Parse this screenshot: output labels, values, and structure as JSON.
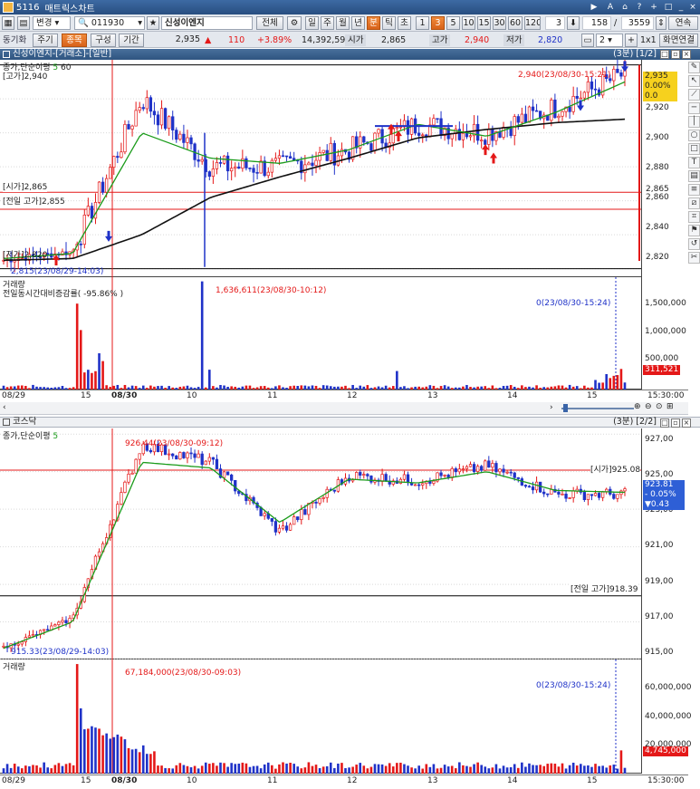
{
  "window": {
    "number": "5116",
    "title": "매트릭스차트",
    "controls": [
      "▶",
      "|",
      "A",
      "⌂",
      "?",
      "+",
      "□",
      "_",
      "□",
      "×"
    ]
  },
  "toolbar": {
    "change_label": "변경",
    "code": "011930",
    "name": "신성이엔지",
    "all_label": "전체",
    "periods": [
      "일",
      "주",
      "월",
      "년",
      "분",
      "틱",
      "초",
      "1",
      "3",
      "5",
      "10",
      "15",
      "30",
      "60",
      "120"
    ],
    "active_period": "분",
    "active_interval": "3",
    "interval_value": "3",
    "count_value": "158",
    "slash": "/",
    "total_value": "3559",
    "continuous_label": "연속",
    "sync_label": "동기화",
    "stock_btn": "주기",
    "item_btn": "종목",
    "config_btn": "구성",
    "period_btn": "기간",
    "price": "2,935",
    "change_arrow": "▲",
    "change": "110",
    "change_pct": "+3.89%",
    "volume": "14,392,599",
    "open_label": "시가",
    "open": "2,865",
    "high_label": "고가",
    "high": "2,940",
    "low_label": "저가",
    "low": "2,820",
    "split_value": "2",
    "scale_label": "1x1",
    "screen_label": "화면연결"
  },
  "chart1": {
    "header": "신성이엔지-[거래소]-[일반]",
    "page": "(3분) [1/2]",
    "legend": "종가,단순이평",
    "legend_ma": "5",
    "legend_ma2": "60",
    "high_label": "[고가]2,940",
    "price_ticks": [
      "2,920",
      "2,900",
      "2,880",
      "2,865",
      "2,860",
      "2,840",
      "2,820"
    ],
    "annotations": {
      "high": "2,940(23/08/30-15:21)",
      "low": "2,815(23/08/29-14:03)",
      "open": "[시가]2,865",
      "prev_high": "[전일 고가]2,855",
      "low_line": "[저가]2,820"
    },
    "price_badge": {
      "price": "2,935",
      "pct": "0.00%",
      "chg": "0.0"
    }
  },
  "volume1": {
    "label": "거래량",
    "sub": "전일동시간대비증감률( -95.86% )",
    "max_ann": "1,636,611(23/08/30-10:12)",
    "last_ann": "0(23/08/30-15:24)",
    "ticks": [
      "1,500,000",
      "1,000,000",
      "500,000"
    ],
    "badge": "311,521"
  },
  "xaxis": {
    "labels": [
      "08/29",
      "15",
      "08/30",
      "10",
      "11",
      "12",
      "13",
      "14",
      "15"
    ],
    "end": "15:30:00"
  },
  "chart2": {
    "header": "코스닥",
    "page": "(3분) [2/2]",
    "legend": "종가,단순이평",
    "legend_ma": "5",
    "ticks": [
      "927,00",
      "925,00",
      "923,00",
      "921,00",
      "919,00",
      "917,00",
      "915,00"
    ],
    "annotations": {
      "high": "926.44(23/08/30-09:12)",
      "low": "915.33(23/08/29-14:03)",
      "open": "[시가]925.08",
      "prev_high": "[전일 고가]918.39"
    },
    "badge": {
      "value": "923.81",
      "pct": "- 0.05%",
      "chg": "▼0.43"
    }
  },
  "volume2": {
    "label": "거래량",
    "max_ann": "67,184,000(23/08/30-09:03)",
    "last_ann": "0(23/08/30-15:24)",
    "ticks": [
      "60,000,000",
      "40,000,000",
      "20,000,000"
    ],
    "badge": "4,745,000"
  },
  "colors": {
    "up": "#e41818",
    "down": "#1f32c8",
    "ma5": "#1a9b1a",
    "ma60": "#111111",
    "bar": "#2f5580",
    "accent": "#e0661e"
  },
  "chart_data": [
    {
      "type": "line",
      "title": "신성이엔지-[거래소]-[일반]",
      "ylim": [
        2815,
        2943
      ],
      "x": [
        "08/29 13:00",
        "08/29 15:00",
        "08/30 09:00",
        "08/30 10:00",
        "08/30 11:00",
        "08/30 12:00",
        "08/30 13:00",
        "08/30 14:00",
        "08/30 15:00",
        "08/30 15:21"
      ],
      "series": [
        {
          "name": "종가",
          "values": [
            2825,
            2830,
            2920,
            2880,
            2880,
            2890,
            2905,
            2900,
            2915,
            2935
          ]
        },
        {
          "name": "단순이평 5",
          "values": [
            2826,
            2829,
            2900,
            2885,
            2882,
            2890,
            2905,
            2898,
            2912,
            2930
          ]
        },
        {
          "name": "단순이평 60",
          "values": [
            2825,
            2826,
            2840,
            2862,
            2874,
            2885,
            2897,
            2902,
            2906,
            2908
          ]
        }
      ]
    },
    {
      "type": "bar",
      "title": "거래량",
      "ylim": [
        0,
        1700000
      ],
      "x": [
        "08/30 09:00",
        "08/30 10:12",
        "08/30 15:15"
      ],
      "values": [
        1300000,
        1636611,
        311521
      ]
    },
    {
      "type": "line",
      "title": "코스닥",
      "ylim": [
        915,
        927.3
      ],
      "x": [
        "08/29 13:00",
        "08/29 15:00",
        "08/30 09:12",
        "08/30 10:00",
        "08/30 10:30",
        "08/30 11:00",
        "08/30 12:00",
        "08/30 13:00",
        "08/30 14:00",
        "08/30 15:20"
      ],
      "series": [
        {
          "name": "종가",
          "values": [
            915.6,
            917.2,
            926.44,
            925.5,
            921.8,
            924.8,
            924.5,
            925.3,
            923.8,
            923.81
          ]
        },
        {
          "name": "단순이평 5",
          "values": [
            915.6,
            917.0,
            925.5,
            925.2,
            922.3,
            924.6,
            924.4,
            925.0,
            924.0,
            923.9
          ]
        }
      ]
    },
    {
      "type": "bar",
      "title": "거래량",
      "ylim": [
        0,
        70000000
      ],
      "x": [
        "08/30 09:03",
        "08/30 15:21"
      ],
      "values": [
        67184000,
        4745000
      ]
    }
  ]
}
